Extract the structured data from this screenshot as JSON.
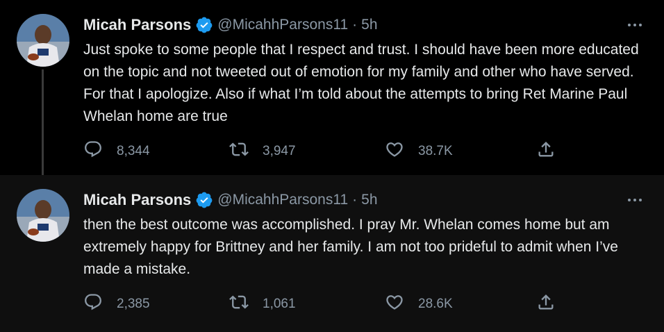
{
  "tweets": [
    {
      "author_name": "Micah Parsons",
      "handle": "@MicahhParsons11",
      "separator": "·",
      "time": "5h",
      "text": "Just spoke to some people that I respect and trust. I should have been more educated on the topic and not tweeted out of emotion for my family and other who have served. For that I apologize. Also if what I’m told about the attempts to bring Ret Marine Paul Whelan home are true",
      "replies": "8,344",
      "retweets": "3,947",
      "likes": "38.7K"
    },
    {
      "author_name": "Micah Parsons",
      "handle": "@MicahhParsons11",
      "separator": "·",
      "time": "5h",
      "text": "then the best outcome was accomplished. I pray Mr. Whelan comes home but am extremely happy for Brittney and her family.  I am not too prideful to admit when I’ve made a mistake.",
      "replies": "2,385",
      "retweets": "1,061",
      "likes": "28.6K"
    }
  ],
  "icons": {
    "verified": "verified-badge-icon",
    "more": "more-options-icon",
    "reply": "reply-icon",
    "retweet": "retweet-icon",
    "like": "like-icon",
    "share": "share-icon"
  },
  "colors": {
    "background": "#000000",
    "secondary_background": "#0f0f0f",
    "primary_text": "#e7e9ea",
    "secondary_text": "#8b98a5",
    "verified_blue": "#1d9bf0"
  }
}
